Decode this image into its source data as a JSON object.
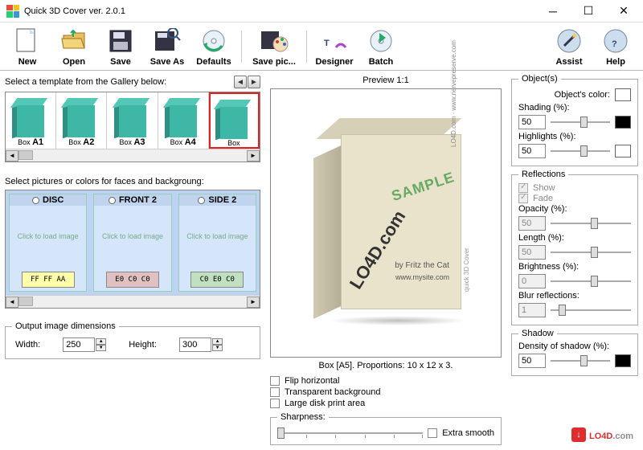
{
  "window": {
    "title": "Quick 3D Cover ver. 2.0.1"
  },
  "toolbar": {
    "new": "New",
    "open": "Open",
    "save": "Save",
    "saveas": "Save As",
    "defaults": "Defaults",
    "savepic": "Save pic...",
    "designer": "Designer",
    "batch": "Batch",
    "assist": "Assist",
    "help": "Help"
  },
  "gallery": {
    "label": "Select a template from the Gallery below:",
    "items": [
      "Box A1",
      "Box A2",
      "Box A3",
      "Box A4",
      "Box"
    ],
    "selected": 4
  },
  "faces": {
    "label": "Select pictures or colors for faces and backgroung:",
    "click_hint": "Click\nto load\nimage",
    "items": [
      {
        "name": "DISC",
        "color_hex": "FF FF AA",
        "swatch": "#ffffaa"
      },
      {
        "name": "FRONT 2",
        "color_hex": "E0 C0 C0",
        "swatch": "#e0c0c0"
      },
      {
        "name": "SIDE 2",
        "color_hex": "C0 E0 C0",
        "swatch": "#c0e0c0"
      }
    ]
  },
  "output": {
    "legend": "Output image dimensions",
    "width_label": "Width:",
    "width": "250",
    "height_label": "Height:",
    "height": "300"
  },
  "preview": {
    "header": "Preview 1:1",
    "caption": "Box [A5]. Proportions: 10 x 12 x 3.",
    "sample": "SAMPLE",
    "diag": "LO4D.com",
    "by": "by Fritz the Cat",
    "url": "www.mysite.com",
    "side1": "LO4D.com · www.nervepreserve.com",
    "side2": "quick 3D Cover",
    "flip": "Flip horizontal",
    "transparent": "Transparent background",
    "largedisk": "Large disk print area",
    "sharp_legend": "Sharpness:",
    "extra": "Extra smooth"
  },
  "objects": {
    "legend": "Object(s)",
    "color_label": "Object's color:",
    "shading_label": "Shading (%):",
    "shading": "50",
    "highlights_label": "Highlights (%):",
    "highlights": "50"
  },
  "reflections": {
    "legend": "Reflections",
    "show": "Show",
    "fade": "Fade",
    "opacity_label": "Opacity (%):",
    "opacity": "50",
    "length_label": "Length (%):",
    "length": "50",
    "brightness_label": "Brightness (%):",
    "brightness": "0",
    "blur_label": "Blur reflections:",
    "blur": "1"
  },
  "shadow": {
    "legend": "Shadow",
    "density_label": "Density of shadow (%):",
    "density": "50"
  },
  "watermark": {
    "main": "LO4D",
    "suffix": ".com"
  }
}
